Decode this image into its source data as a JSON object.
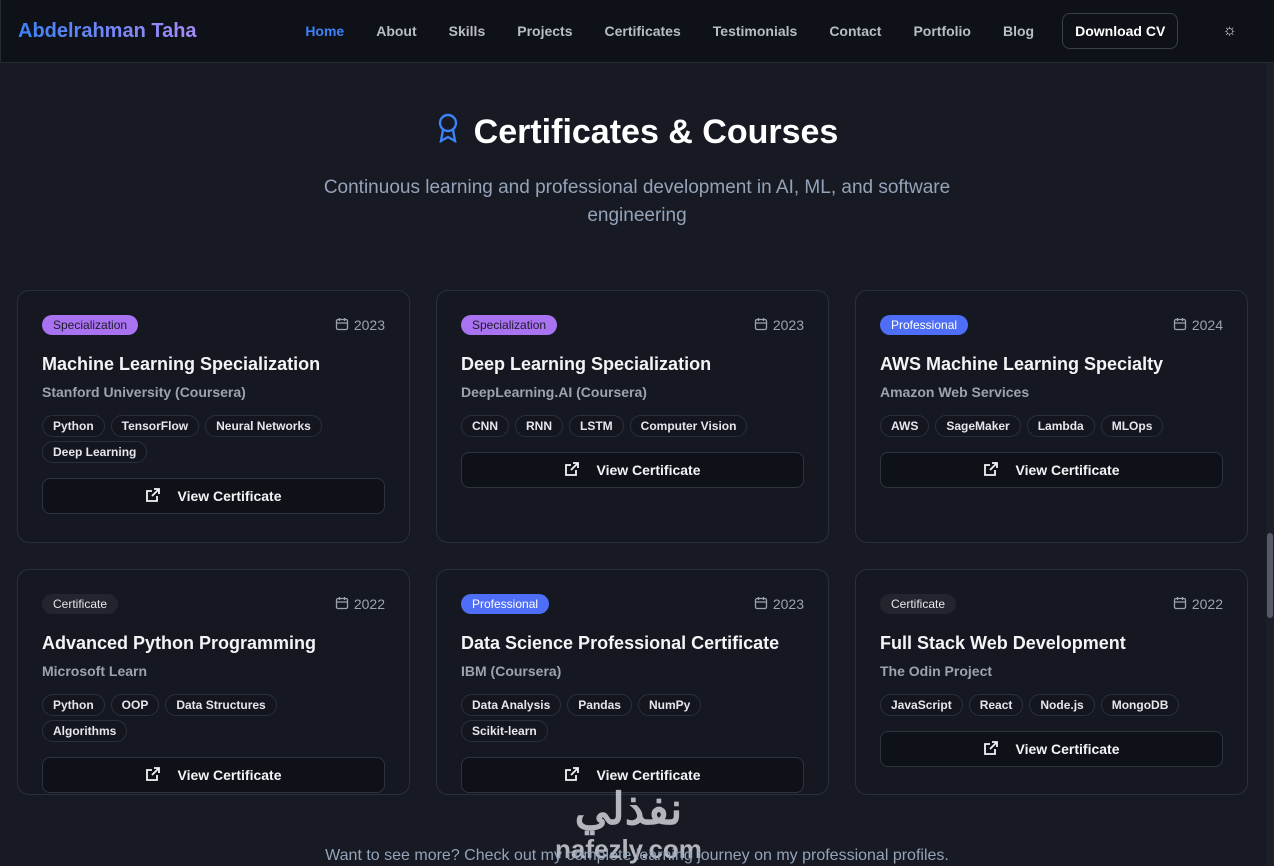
{
  "nav": {
    "brand": "Abdelrahman Taha",
    "links": [
      "Home",
      "About",
      "Skills",
      "Projects",
      "Certificates",
      "Testimonials",
      "Contact",
      "Portfolio",
      "Blog"
    ],
    "download": "Download CV"
  },
  "hero": {
    "title": "Certificates & Courses",
    "subtitle": "Continuous learning and professional development in AI, ML, and software engineering"
  },
  "cards": [
    {
      "badge": "Specialization",
      "type": "spec",
      "year": "2023",
      "title": "Machine Learning Specialization",
      "issuer": "Stanford University (Coursera)",
      "tags": [
        "Python",
        "TensorFlow",
        "Neural Networks",
        "Deep Learning"
      ],
      "button": "View Certificate"
    },
    {
      "badge": "Specialization",
      "type": "spec",
      "year": "2023",
      "title": "Deep Learning Specialization",
      "issuer": "DeepLearning.AI (Coursera)",
      "tags": [
        "CNN",
        "RNN",
        "LSTM",
        "Computer Vision"
      ],
      "button": "View Certificate"
    },
    {
      "badge": "Professional",
      "type": "pro",
      "year": "2024",
      "title": "AWS Machine Learning Specialty",
      "issuer": "Amazon Web Services",
      "tags": [
        "AWS",
        "SageMaker",
        "Lambda",
        "MLOps"
      ],
      "button": "View Certificate"
    },
    {
      "badge": "Certificate",
      "type": "cert",
      "year": "2022",
      "title": "Advanced Python Programming",
      "issuer": "Microsoft Learn",
      "tags": [
        "Python",
        "OOP",
        "Data Structures",
        "Algorithms"
      ],
      "button": "View Certificate"
    },
    {
      "badge": "Professional",
      "type": "pro",
      "year": "2023",
      "title": "Data Science Professional Certificate",
      "issuer": "IBM (Coursera)",
      "tags": [
        "Data Analysis",
        "Pandas",
        "NumPy",
        "Scikit-learn"
      ],
      "button": "View Certificate"
    },
    {
      "badge": "Certificate",
      "type": "cert",
      "year": "2022",
      "title": "Full Stack Web Development",
      "issuer": "The Odin Project",
      "tags": [
        "JavaScript",
        "React",
        "Node.js",
        "MongoDB"
      ],
      "button": "View Certificate"
    }
  ],
  "footer": {
    "text": "Want to see more? Check out my complete learning journey on my professional profiles."
  },
  "watermark": {
    "arabic": "نفذلي",
    "latin": "nafezly.com"
  }
}
